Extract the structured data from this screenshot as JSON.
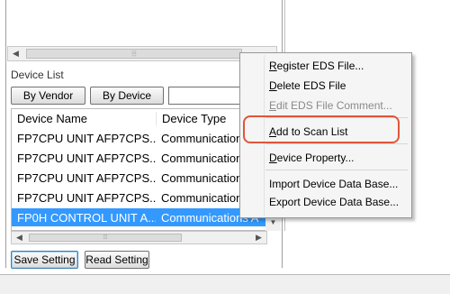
{
  "top_scrollbar": {
    "thumb_glyph": "⦙⦙⦙"
  },
  "device_list": {
    "title": "Device List",
    "buttons": {
      "by_vendor": "By Vendor",
      "by_device": "By Device"
    },
    "search_value": "",
    "columns": [
      "Device Name",
      "Device Type"
    ],
    "rows": [
      {
        "name": "FP7CPU UNIT AFP7CPS...",
        "type": "Communication"
      },
      {
        "name": "FP7CPU UNIT AFP7CPS...",
        "type": "Communication"
      },
      {
        "name": "FP7CPU UNIT AFP7CPS...",
        "type": "Communication"
      },
      {
        "name": "FP7CPU UNIT AFP7CPS...",
        "type": "Communication"
      },
      {
        "name": "FP0H CONTROL UNIT A...",
        "type": "Communications A",
        "selected": true
      }
    ],
    "scroll_thumb_glyph": "⦙⦙⦙"
  },
  "footer": {
    "save_setting": "Save Setting",
    "read_setting": "Read Setting"
  },
  "context_menu": {
    "items": [
      {
        "label": "Register EDS File...",
        "mnemonic": "R",
        "enabled": true
      },
      {
        "label": "Delete EDS File",
        "mnemonic": "D",
        "enabled": true
      },
      {
        "label": "Edit EDS File Comment...",
        "mnemonic": "E",
        "enabled": false
      },
      {
        "label": "Add to Scan List",
        "mnemonic": "A",
        "enabled": true,
        "highlighted": true
      },
      {
        "label": "Device Property...",
        "mnemonic": "D",
        "enabled": true
      },
      {
        "label": "Import Device Data Base...",
        "mnemonic": "",
        "enabled": true
      },
      {
        "label": "Export Device Data Base...",
        "mnemonic": "",
        "enabled": true
      }
    ]
  },
  "colors": {
    "selection": "#3399ff",
    "highlight_outline": "#e0553b",
    "panel_border": "#a0a0a0"
  }
}
